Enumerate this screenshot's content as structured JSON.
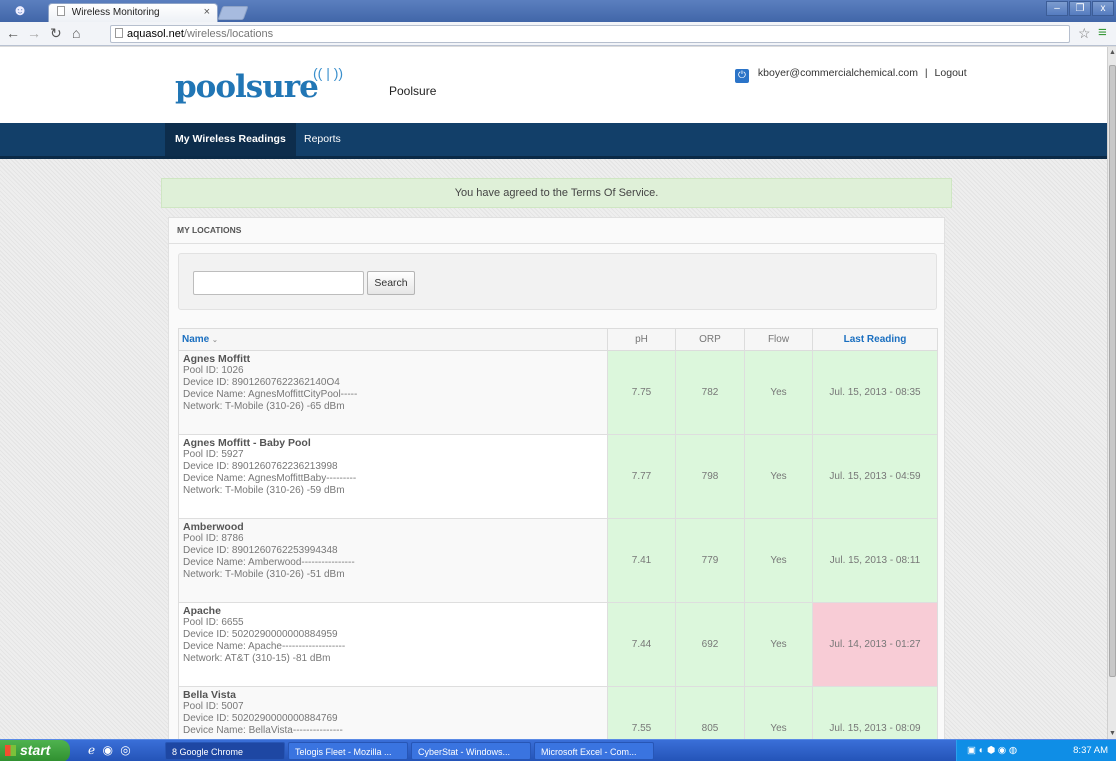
{
  "browser": {
    "tab_title": "Wireless Monitoring",
    "tab_close": "×",
    "url_host": "aquasol.net",
    "url_path": "/wireless/locations",
    "window_buttons": [
      "–",
      "❐",
      "x"
    ]
  },
  "site": {
    "logo_text": "poolsure",
    "brand_name": "Poolsure",
    "user_email": "kboyer@commercialchemical.com",
    "separator": "|",
    "logout": "Logout"
  },
  "nav": {
    "items": [
      "My Wireless Readings",
      "Reports"
    ]
  },
  "alert": {
    "message": "You have agreed to the Terms Of Service."
  },
  "panel": {
    "title": "MY LOCATIONS",
    "search_value": "",
    "search_button": "Search"
  },
  "table": {
    "headers": [
      "Name",
      "pH",
      "ORP",
      "Flow",
      "Last Reading"
    ],
    "rows": [
      {
        "name": "Agnes Moffitt",
        "pool_id": "Pool ID: 1026",
        "device_id": "Device ID: 89012607622362140O4",
        "device_name": "Device Name: AgnesMoffittCityPool-----",
        "network": "Network: T-Mobile (310-26) -65 dBm",
        "ph": "7.75",
        "orp": "782",
        "flow": "Yes",
        "last": "Jul. 15, 2013 - 08:35",
        "status": "good"
      },
      {
        "name": "Agnes Moffitt - Baby Pool",
        "pool_id": "Pool ID: 5927",
        "device_id": "Device ID: 8901260762236213998",
        "device_name": "Device Name: AgnesMoffittBaby---------",
        "network": "Network: T-Mobile (310-26) -59 dBm",
        "ph": "7.77",
        "orp": "798",
        "flow": "Yes",
        "last": "Jul. 15, 2013 - 04:59",
        "status": "good"
      },
      {
        "name": "Amberwood",
        "pool_id": "Pool ID: 8786",
        "device_id": "Device ID: 8901260762253994348",
        "device_name": "Device Name: Amberwood----------------",
        "network": "Network: T-Mobile (310-26) -51 dBm",
        "ph": "7.41",
        "orp": "779",
        "flow": "Yes",
        "last": "Jul. 15, 2013 - 08:11",
        "status": "good"
      },
      {
        "name": "Apache",
        "pool_id": "Pool ID: 6655",
        "device_id": "Device ID: 5020290000000884959",
        "device_name": "Device Name: Apache-------------------",
        "network": "Network: AT&T (310-15) -81 dBm",
        "ph": "7.44",
        "orp": "692",
        "flow": "Yes",
        "last": "Jul. 14, 2013 - 01:27",
        "status": "bad"
      },
      {
        "name": "Bella Vista",
        "pool_id": "Pool ID: 5007",
        "device_id": "Device ID: 5020290000000884769",
        "device_name": "Device Name: BellaVista---------------",
        "network": "",
        "ph": "7.55",
        "orp": "805",
        "flow": "Yes",
        "last": "Jul. 15, 2013 - 08:09",
        "status": "good"
      }
    ]
  },
  "taskbar": {
    "start": "start",
    "tasks": [
      "8 Google Chrome",
      "Telogis Fleet - Mozilla ...",
      "CyberStat - Windows...",
      "Microsoft Excel - Com..."
    ],
    "clock": "8:37 AM"
  }
}
